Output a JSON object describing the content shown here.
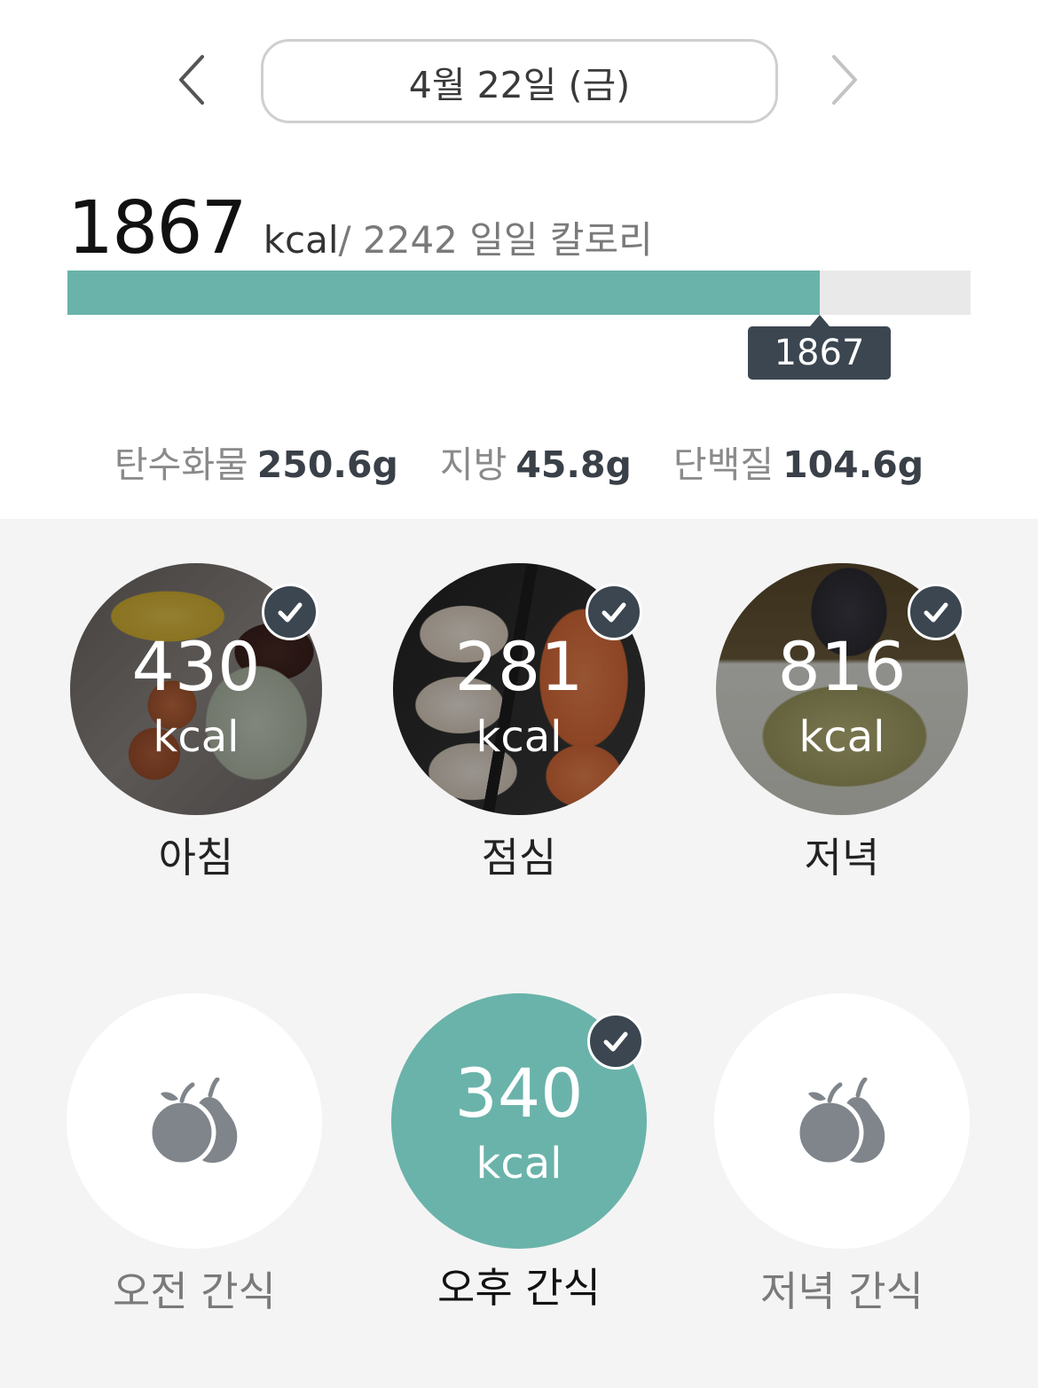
{
  "date_nav": {
    "date_label": "4월 22일 (금)",
    "prev_icon": "chevron-left-icon",
    "next_icon": "chevron-right-icon"
  },
  "calories": {
    "consumed": "1867",
    "unit": "kcal",
    "goal_text": "/ 2242 일일 칼로리",
    "tooltip": "1867",
    "progress_fraction": 0.8327
  },
  "macros": [
    {
      "label": "탄수화물",
      "value": "250.6g"
    },
    {
      "label": "지방",
      "value": "45.8g"
    },
    {
      "label": "단백질",
      "value": "104.6g"
    }
  ],
  "meals": [
    {
      "label": "아침",
      "kcal": "430",
      "unit": "kcal",
      "checked": true
    },
    {
      "label": "점심",
      "kcal": "281",
      "unit": "kcal",
      "checked": true
    },
    {
      "label": "저녁",
      "kcal": "816",
      "unit": "kcal",
      "checked": true
    }
  ],
  "snacks": [
    {
      "label": "오전 간식",
      "icon": "fruit-icon",
      "checked": false
    },
    {
      "label": "오후 간식",
      "kcal": "340",
      "unit": "kcal",
      "checked": true
    },
    {
      "label": "저녁 간식",
      "icon": "fruit-icon",
      "checked": false
    }
  ],
  "colors": {
    "accent": "#6ab3aa",
    "dark": "#3b4650",
    "track": "#e9e9e9",
    "icon_gray": "#7f858b"
  }
}
